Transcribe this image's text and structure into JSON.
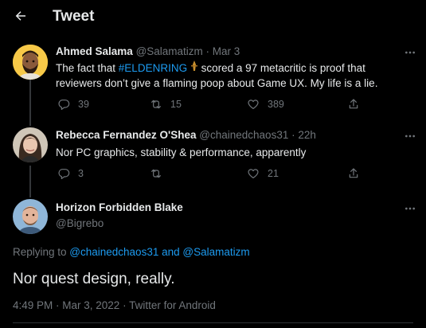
{
  "header": {
    "title": "Tweet"
  },
  "tweets": [
    {
      "name": "Ahmed Salama",
      "handle": "@Salamatizm",
      "time": "Mar 3",
      "text_before": "The fact that ",
      "hashtag": "#ELDENRING",
      "text_after": " scored a 97 metacritic is proof that reviewers don’t give a flaming poop about Game UX. My life is a lie.",
      "replies": "39",
      "retweets": "15",
      "likes": "389"
    },
    {
      "name": "Rebecca Fernandez O'Shea",
      "handle": "@chainedchaos31",
      "time": "22h",
      "text": "Nor PC graphics, stability & performance, apparently",
      "replies": "3",
      "retweets": "",
      "likes": "21"
    }
  ],
  "focus": {
    "name": "Horizon Forbidden Blake",
    "handle": "@Bigrebo",
    "replying_prefix": "Replying to ",
    "replying_user1": "@chainedchaos31",
    "replying_and": " and ",
    "replying_user2": "@Salamatizm",
    "text": "Nor quest design, really.",
    "timestamp": "4:49 PM · Mar 3, 2022 · Twitter for Android"
  },
  "separator": " · ",
  "colors": {
    "background": "#000000",
    "accent": "#1d9bf0",
    "muted": "#71767b",
    "text": "#e7e9ea"
  }
}
